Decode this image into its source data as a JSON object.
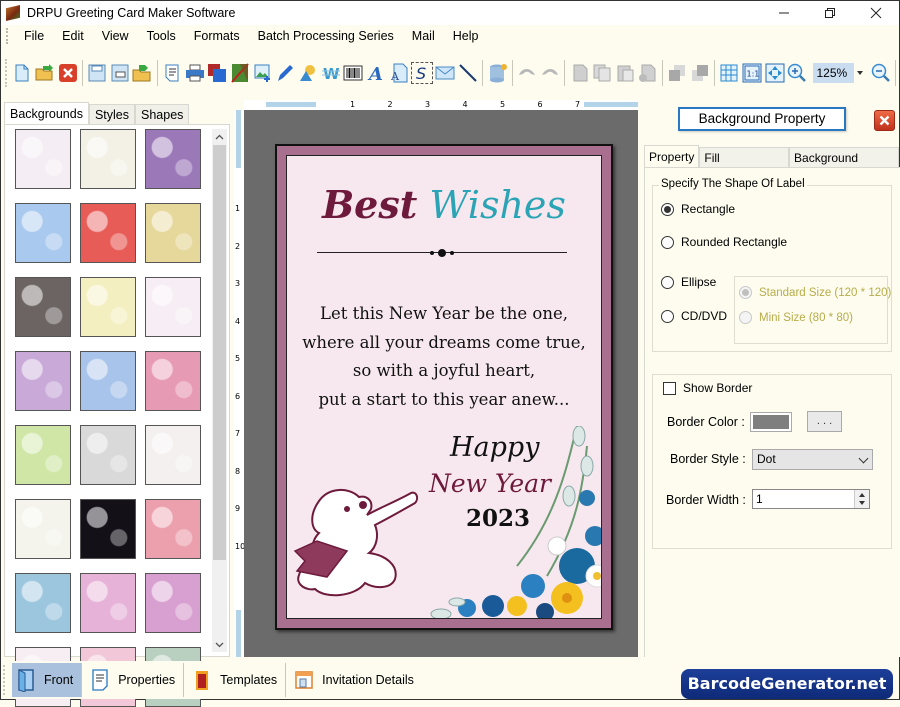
{
  "window": {
    "title": "DRPU Greeting Card Maker Software",
    "controls": [
      "minimize",
      "restore",
      "close"
    ]
  },
  "menu": [
    "File",
    "Edit",
    "View",
    "Tools",
    "Formats",
    "Batch Processing Series",
    "Mail",
    "Help"
  ],
  "toolbar": {
    "icons": [
      "new-icon",
      "open-icon",
      "close-doc-icon",
      "save-icon",
      "save-as-icon",
      "open-template-icon",
      "print-preview-icon",
      "print-icon",
      "copy-design-icon",
      "background-icon",
      "insert-image-icon",
      "signature-icon",
      "shapes-icon",
      "watermark-icon",
      "barcode-icon",
      "text-icon",
      "word-art-icon",
      "symbol-icon",
      "mail-icon",
      "line-icon",
      "database-icon",
      "undo-icon",
      "redo-icon",
      "cut-icon",
      "copy-icon",
      "paste-icon",
      "delete-icon",
      "bring-front-icon",
      "send-back-icon",
      "grid-icon",
      "actual-size-icon",
      "fit-window-icon",
      "zoom-in-icon",
      "zoom-out-icon"
    ],
    "zoom_value": "125%"
  },
  "left_panel": {
    "tabs": [
      "Backgrounds",
      "Styles",
      "Shapes"
    ],
    "active_tab": "Backgrounds",
    "thumbnails": [
      {
        "name": "baby-doodles",
        "color": "#f4eef4"
      },
      {
        "name": "baby-sketch",
        "color": "#f3f1e6"
      },
      {
        "name": "purple-flowers",
        "color": "#9b78b8"
      },
      {
        "name": "blue-sky-clouds",
        "color": "#a9c9ee"
      },
      {
        "name": "strawberries",
        "color": "#e85c58"
      },
      {
        "name": "autumn-leaves",
        "color": "#e6d79a"
      },
      {
        "name": "dark-petals",
        "color": "#6b6462"
      },
      {
        "name": "yellow-bunting",
        "color": "#f4efc0"
      },
      {
        "name": "gift-boxes",
        "color": "#f6eef4"
      },
      {
        "name": "pastel-flowers",
        "color": "#c8a9d8"
      },
      {
        "name": "blue-snowflakes",
        "color": "#a8c4ea"
      },
      {
        "name": "mandala-flowers",
        "color": "#e79ab4"
      },
      {
        "name": "green-trees",
        "color": "#cfe6a6"
      },
      {
        "name": "white-heart",
        "color": "#d9d9d9"
      },
      {
        "name": "kids-doodles",
        "color": "#f5f0f0"
      },
      {
        "name": "wedding-bells",
        "color": "#f4f4ec"
      },
      {
        "name": "fireworks",
        "color": "#141018"
      },
      {
        "name": "red-hearts",
        "color": "#eca0ae"
      },
      {
        "name": "santa-pattern",
        "color": "#9cc6de"
      },
      {
        "name": "pink-bokeh",
        "color": "#e6b2d8"
      },
      {
        "name": "pink-poinsettia",
        "color": "#d8a0d0"
      },
      {
        "name": "colorful-stars",
        "color": "#f6eef2"
      },
      {
        "name": "pink-texture",
        "color": "#f2c8d8"
      },
      {
        "name": "christmas-figures",
        "color": "#b9cfc0"
      }
    ]
  },
  "rulers": {
    "top": [
      "1",
      "2",
      "3",
      "4",
      "5",
      "6",
      "7"
    ],
    "left": [
      "1",
      "2",
      "3",
      "4",
      "5",
      "6",
      "7",
      "8",
      "9",
      "10"
    ]
  },
  "card": {
    "title_part1": "Best",
    "title_part2": "Wishes",
    "poem": [
      "Let this New Year be the one,",
      "where all your dreams come true,",
      "so with a joyful heart,",
      "put a start to this year anew..."
    ],
    "greeting_line1": "Happy",
    "greeting_line2": "New Year",
    "year": "2023",
    "colors": {
      "border": "#a86f8e",
      "background": "#f6e8ee",
      "accent_maroon": "#6e1a3c",
      "accent_teal": "#2ba4b6"
    }
  },
  "right_panel": {
    "header_button": "Background Property",
    "tabs": [
      "Property",
      "Fill Background",
      "Background Effects"
    ],
    "active_tab": "Property",
    "shape_group": {
      "legend": "Specify The Shape Of Label",
      "options": [
        {
          "label": "Rectangle",
          "checked": true
        },
        {
          "label": "Rounded Rectangle",
          "checked": false
        },
        {
          "label": "Ellipse",
          "checked": false
        },
        {
          "label": "CD/DVD",
          "checked": false
        }
      ],
      "cd_sizes": [
        {
          "label": "Standard Size (120 * 120)",
          "checked": true,
          "enabled": false
        },
        {
          "label": "Mini Size (80 * 80)",
          "checked": false,
          "enabled": false
        }
      ]
    },
    "border_group": {
      "show_border_label": "Show Border",
      "show_border_checked": false,
      "border_color_label": "Border Color :",
      "border_color_value": "#7f7f7f",
      "color_picker_button": ". . .",
      "border_style_label": "Border Style :",
      "border_style_value": "Dot",
      "border_width_label": "Border Width :",
      "border_width_value": "1"
    }
  },
  "bottom_tabs": [
    {
      "label": "Front",
      "icon": "front-page-icon",
      "active": true
    },
    {
      "label": "Properties",
      "icon": "properties-icon",
      "active": false
    },
    {
      "label": "Templates",
      "icon": "templates-icon",
      "active": false
    },
    {
      "label": "Invitation Details",
      "icon": "invitation-details-icon",
      "active": false
    }
  ],
  "watermark": "BarcodeGenerator.net"
}
